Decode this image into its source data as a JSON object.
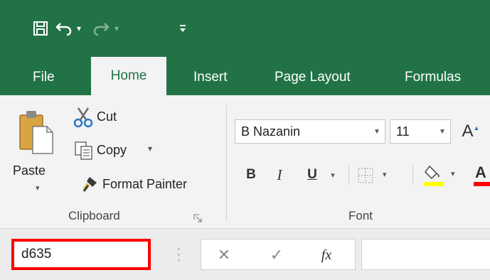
{
  "quick_access": {
    "save_icon": "save-icon",
    "undo_icon": "undo-icon",
    "redo_icon": "redo-icon",
    "customize_icon": "customize-qat-icon"
  },
  "tabs": [
    {
      "label": "File"
    },
    {
      "label": "Home",
      "active": true
    },
    {
      "label": "Insert"
    },
    {
      "label": "Page Layout"
    },
    {
      "label": "Formulas"
    }
  ],
  "clipboard": {
    "paste": "Paste",
    "cut": "Cut",
    "copy": "Copy",
    "format_painter": "Format Painter",
    "group_label": "Clipboard"
  },
  "font": {
    "name": "B Nazanin",
    "size": "11",
    "group_label": "Font",
    "bold": "B",
    "italic": "I",
    "underline": "U",
    "fill_color": "#ffff00",
    "font_color": "#ff0000"
  },
  "formula_bar": {
    "name_box": "d635",
    "cancel": "✕",
    "enter": "✓",
    "fx": "fx",
    "formula": "",
    "highlight_color": "#ff0000"
  },
  "colors": {
    "excel_green": "#217346",
    "ribbon_bg": "#f3f3f3"
  }
}
